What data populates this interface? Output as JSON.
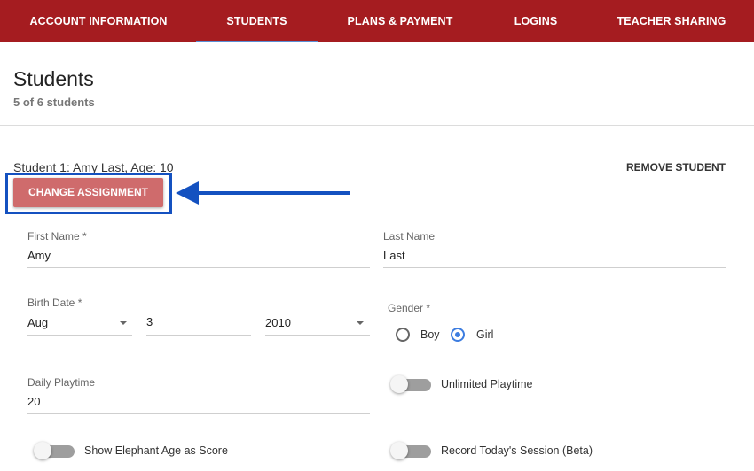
{
  "nav": {
    "tabs": [
      {
        "label": "ACCOUNT INFORMATION"
      },
      {
        "label": "STUDENTS",
        "active": true
      },
      {
        "label": "PLANS & PAYMENT"
      },
      {
        "label": "LOGINS"
      },
      {
        "label": "TEACHER SHARING"
      }
    ]
  },
  "header": {
    "title": "Students",
    "subtitle": "5 of 6 students"
  },
  "student": {
    "heading": "Student 1: Amy Last, Age: 10",
    "remove_label": "REMOVE STUDENT",
    "change_assignment_label": "CHANGE ASSIGNMENT",
    "first_name": {
      "label": "First Name *",
      "value": "Amy"
    },
    "last_name": {
      "label": "Last Name",
      "value": "Last"
    },
    "birth_date": {
      "label": "Birth Date *",
      "month": "Aug",
      "day": "3",
      "year": "2010"
    },
    "gender": {
      "label": "Gender *",
      "options": [
        "Boy",
        "Girl"
      ],
      "selected": "Girl"
    },
    "daily_playtime": {
      "label": "Daily Playtime",
      "value": "20"
    },
    "unlimited_playtime": {
      "label": "Unlimited Playtime",
      "on": false
    },
    "elephant_age": {
      "label": "Show Elephant Age as Score",
      "on": false
    },
    "record_session": {
      "label": "Record Today's Session (Beta)",
      "on": false
    }
  },
  "colors": {
    "nav_bg": "#a51c20",
    "active_tab_ink": "#5a8fd6",
    "change_button": "#cf6b6c",
    "annotation_blue": "#1451c0",
    "radio_selected": "#3d7de0"
  },
  "annotation": {
    "highlight_icon": "arrow-left-icon"
  }
}
